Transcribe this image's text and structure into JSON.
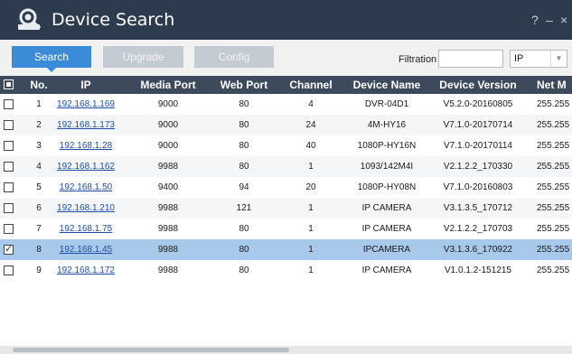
{
  "window": {
    "title": "Device Search",
    "help_label": "?",
    "minimize_label": "–",
    "close_label": "×",
    "icon": "device-search-logo-icon"
  },
  "toolbar": {
    "search_label": "Search",
    "upgrade_label": "Upgrade",
    "config_label": "Config",
    "filtration_label": "Filtration",
    "filtration_value": "",
    "filter_select_value": "IP",
    "filter_select_arrow": "▼"
  },
  "table": {
    "columns": [
      "No.",
      "IP",
      "Media Port",
      "Web Port",
      "Channel",
      "Device Name",
      "Device Version",
      "Net M"
    ],
    "rows": [
      {
        "no": "1",
        "ip": "192.168.1.169",
        "media_port": "9000",
        "web_port": "80",
        "channel": "4",
        "device_name": "DVR-04D1",
        "device_version": "V5.2.0-20160805",
        "net_mask": "255.255",
        "checked": false
      },
      {
        "no": "2",
        "ip": "192.168.1.173",
        "media_port": "9000",
        "web_port": "80",
        "channel": "24",
        "device_name": "4M-HY16",
        "device_version": "V7.1.0-20170714",
        "net_mask": "255.255",
        "checked": false
      },
      {
        "no": "3",
        "ip": "192.168.1.28",
        "media_port": "9000",
        "web_port": "80",
        "channel": "40",
        "device_name": "1080P-HY16N",
        "device_version": "V7.1.0-20170114",
        "net_mask": "255.255",
        "checked": false
      },
      {
        "no": "4",
        "ip": "192.168.1.162",
        "media_port": "9988",
        "web_port": "80",
        "channel": "1",
        "device_name": "1093/142M4I",
        "device_version": "V2.1.2.2_170330",
        "net_mask": "255.255",
        "checked": false
      },
      {
        "no": "5",
        "ip": "192.168.1.50",
        "media_port": "9400",
        "web_port": "94",
        "channel": "20",
        "device_name": "1080P-HY08N",
        "device_version": "V7.1.0-20160803",
        "net_mask": "255.255",
        "checked": false
      },
      {
        "no": "6",
        "ip": "192.168.1.210",
        "media_port": "9988",
        "web_port": "121",
        "channel": "1",
        "device_name": "IP CAMERA",
        "device_version": "V3.1.3.5_170712",
        "net_mask": "255.255",
        "checked": false
      },
      {
        "no": "7",
        "ip": "192.168.1.75",
        "media_port": "9988",
        "web_port": "80",
        "channel": "1",
        "device_name": "IP CAMERA",
        "device_version": "V2.1.2.2_170703",
        "net_mask": "255.255",
        "checked": false
      },
      {
        "no": "8",
        "ip": "192.168.1.45",
        "media_port": "9988",
        "web_port": "80",
        "channel": "1",
        "device_name": "IPCAMERA",
        "device_version": "V3.1.3.6_170922",
        "net_mask": "255.255",
        "checked": true
      },
      {
        "no": "9",
        "ip": "192.168.1.172",
        "media_port": "9988",
        "web_port": "80",
        "channel": "1",
        "device_name": "IP CAMERA",
        "device_version": "V1.0.1.2-151215",
        "net_mask": "255.255",
        "checked": false
      }
    ],
    "selected_row": "8"
  },
  "colors": {
    "titlebar": "#2c3b4e",
    "header": "#3d4a5c",
    "accent": "#3a8bd8",
    "selected_row": "#a8c9ea",
    "link": "#1d4ea6"
  }
}
